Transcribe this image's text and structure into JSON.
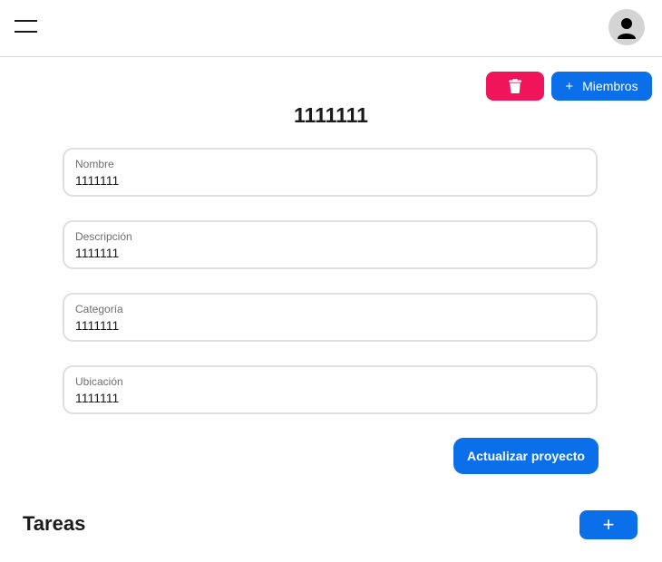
{
  "header": {
    "menu_icon": "hamburger-menu-icon",
    "avatar_icon": "user-avatar-icon"
  },
  "toolbar": {
    "delete_icon": "trash-icon",
    "members_plus": "+",
    "members_label": "Miembros"
  },
  "project": {
    "title": "1111111"
  },
  "form": {
    "fields": [
      {
        "label": "Nombre",
        "value": "1111111"
      },
      {
        "label": "Descripción",
        "value": "1111111"
      },
      {
        "label": "Categoría",
        "value": "1111111"
      },
      {
        "label": "Ubicación",
        "value": "1111111"
      }
    ],
    "submit_label": "Actualizar proyecto"
  },
  "tasks": {
    "title": "Tareas",
    "add_label": "+"
  },
  "colors": {
    "primary": "#0a6fe8",
    "danger": "#f0145a",
    "avatar_bg": "#d4d4d4"
  }
}
